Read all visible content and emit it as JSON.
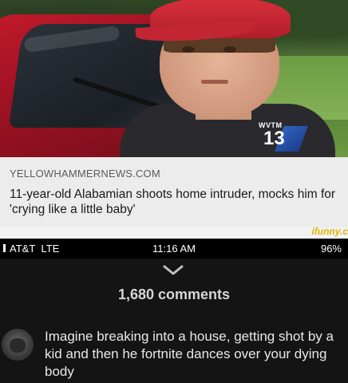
{
  "news": {
    "source": "YELLOWHAMMERNEWS.COM",
    "headline": "11-year-old Alabamian shoots home intruder, mocks him for 'crying like a little baby'",
    "station_logo_top": "WVTM",
    "station_logo_number": "13",
    "watermark": "ifunny.c"
  },
  "status_bar": {
    "carrier": "AT&T",
    "network": "LTE",
    "time": "11:16 AM",
    "battery": "96%"
  },
  "comments": {
    "collapse_icon": "chevron-down-icon",
    "count_label": "1,680 comments",
    "items": [
      {
        "avatar": "gorilla-avatar",
        "text": "Imagine breaking into a house, getting shot by a kid and then he fortnite dances over your dying body"
      }
    ]
  },
  "colors": {
    "caption_bg": "#ececec",
    "dark_bg": "#141414",
    "watermark": "#e0b400",
    "logo_blue": "#2f6fd8"
  }
}
